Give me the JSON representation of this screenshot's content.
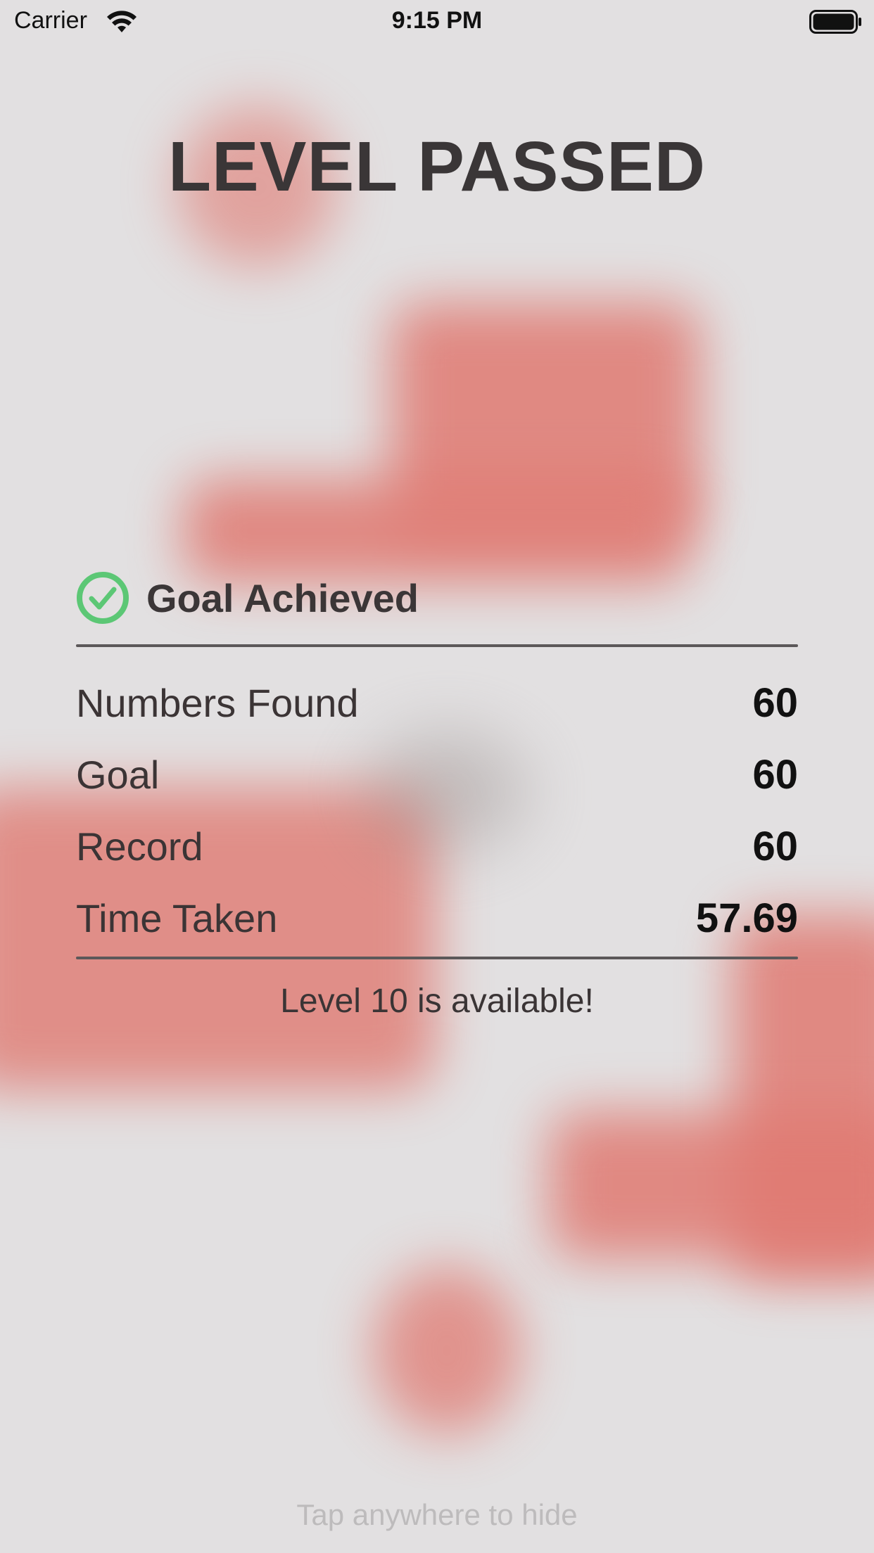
{
  "status_bar": {
    "carrier": "Carrier",
    "time": "9:15 PM",
    "wifi_icon": "wifi-icon",
    "battery_icon": "battery-icon"
  },
  "title": "LEVEL PASSED",
  "goal": {
    "icon": "check-circle-icon",
    "icon_color": "#5cc775",
    "label": "Goal Achieved"
  },
  "stats": [
    {
      "label": "Numbers Found",
      "value": "60"
    },
    {
      "label": "Goal",
      "value": "60"
    },
    {
      "label": "Record",
      "value": "60"
    },
    {
      "label": "Time Taken",
      "value": "57.69"
    }
  ],
  "unlock_message": "Level 10 is available!",
  "hint": "Tap anywhere to hide",
  "colors": {
    "background": "#e2e0e1",
    "blob": "#e07a72",
    "success": "#5cc775"
  }
}
